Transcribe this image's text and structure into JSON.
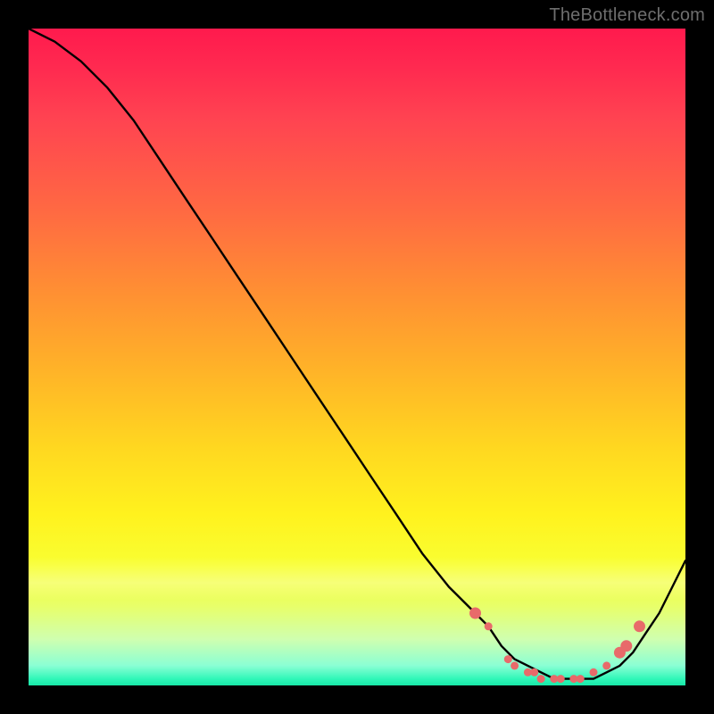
{
  "watermark": "TheBottleneck.com",
  "chart_data": {
    "type": "line",
    "title": "",
    "xlabel": "",
    "ylabel": "",
    "xlim": [
      0,
      100
    ],
    "ylim": [
      0,
      100
    ],
    "grid": false,
    "legend": false,
    "series": [
      {
        "name": "curve",
        "x": [
          0,
          4,
          8,
          12,
          16,
          20,
          24,
          28,
          32,
          36,
          40,
          44,
          48,
          52,
          56,
          60,
          64,
          68,
          70,
          72,
          74,
          76,
          78,
          80,
          82,
          84,
          86,
          88,
          90,
          92,
          94,
          96,
          98,
          100
        ],
        "y": [
          100,
          98,
          95,
          91,
          86,
          80,
          74,
          68,
          62,
          56,
          50,
          44,
          38,
          32,
          26,
          20,
          15,
          11,
          9,
          6,
          4,
          3,
          2,
          1,
          1,
          1,
          1,
          2,
          3,
          5,
          8,
          11,
          15,
          19
        ]
      }
    ],
    "markers": {
      "name": "highlight-points",
      "color": "#e86a6a",
      "radius_small": 4.5,
      "radius_large": 6.5,
      "points": [
        {
          "x": 68,
          "y": 11,
          "r": "large"
        },
        {
          "x": 70,
          "y": 9,
          "r": "small"
        },
        {
          "x": 73,
          "y": 4,
          "r": "small"
        },
        {
          "x": 74,
          "y": 3,
          "r": "small"
        },
        {
          "x": 76,
          "y": 2,
          "r": "small"
        },
        {
          "x": 77,
          "y": 2,
          "r": "small"
        },
        {
          "x": 78,
          "y": 1,
          "r": "small"
        },
        {
          "x": 80,
          "y": 1,
          "r": "small"
        },
        {
          "x": 81,
          "y": 1,
          "r": "small"
        },
        {
          "x": 83,
          "y": 1,
          "r": "small"
        },
        {
          "x": 84,
          "y": 1,
          "r": "small"
        },
        {
          "x": 86,
          "y": 2,
          "r": "small"
        },
        {
          "x": 88,
          "y": 3,
          "r": "small"
        },
        {
          "x": 90,
          "y": 5,
          "r": "large"
        },
        {
          "x": 91,
          "y": 6,
          "r": "large"
        },
        {
          "x": 93,
          "y": 9,
          "r": "large"
        }
      ]
    },
    "background_gradient_stops": [
      {
        "pos": 0,
        "color": "#ff1a4d"
      },
      {
        "pos": 40,
        "color": "#ff8f33"
      },
      {
        "pos": 74,
        "color": "#fff21e"
      },
      {
        "pos": 100,
        "color": "#18e8a8"
      }
    ]
  }
}
